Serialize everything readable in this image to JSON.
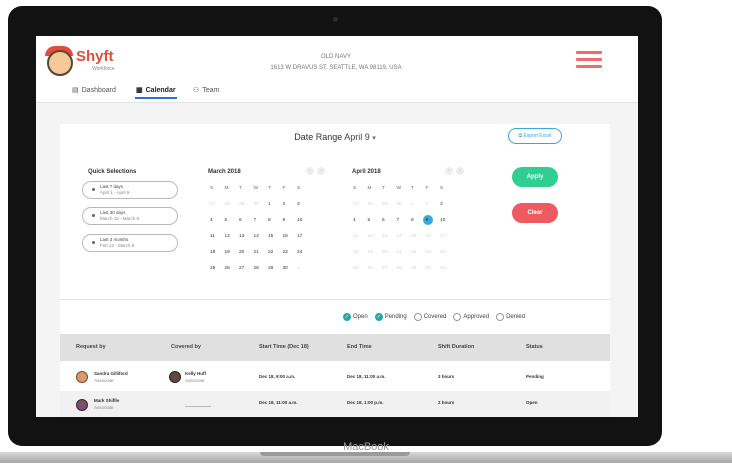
{
  "device_label": "MacBook",
  "app": {
    "brand": "Shyft",
    "brand_sub": "Workforce",
    "store_name": "OLD NAVY",
    "store_address": "1613 W DRAVUS ST. SEATTLE, WA 98119, USA"
  },
  "nav": {
    "dashboard": "Dashboard",
    "calendar": "Calendar",
    "team": "Team"
  },
  "date_range": {
    "label": "Date Range",
    "value": "April 9",
    "caret": "▾"
  },
  "export_label": "Export Excel",
  "quick_selections": {
    "title": "Quick Selections",
    "items": [
      {
        "label": "Last 7 days",
        "range": "April 1 - April 9"
      },
      {
        "label": "Last 30 days",
        "range": "March 15 - March 9"
      },
      {
        "label": "Last 3 months",
        "range": "Feb 13 - March 9"
      }
    ]
  },
  "calendars": [
    {
      "title": "March 2018",
      "weekdays": [
        "S",
        "M",
        "T",
        "W",
        "T",
        "F",
        "S"
      ],
      "weeks": [
        [
          "26",
          "27",
          "28",
          "29",
          "30",
          "1",
          "2",
          "3"
        ],
        [
          "4",
          "5",
          "6",
          "7",
          "8",
          "9",
          "10"
        ],
        [
          "11",
          "12",
          "13",
          "14",
          "15",
          "16",
          "17"
        ],
        [
          "18",
          "19",
          "20",
          "21",
          "22",
          "23",
          "24"
        ],
        [
          "25",
          "26",
          "27",
          "28",
          "29",
          "30",
          "1"
        ]
      ]
    },
    {
      "title": "April 2018",
      "weekdays": [
        "S",
        "M",
        "T",
        "W",
        "T",
        "F",
        "S"
      ],
      "weeks": [
        [
          "27",
          "28",
          "29",
          "30",
          "1",
          "2",
          "3"
        ],
        [
          "4",
          "5",
          "6",
          "7",
          "8",
          "9",
          "10"
        ],
        [
          "11",
          "12",
          "13",
          "14",
          "15",
          "16",
          "17"
        ],
        [
          "18",
          "19",
          "20",
          "21",
          "22",
          "23",
          "24"
        ],
        [
          "25",
          "26",
          "27",
          "28",
          "29",
          "30",
          "31"
        ]
      ]
    }
  ],
  "apply_label": "Apply",
  "clear_label": "Clear",
  "filters": [
    {
      "label": "Open",
      "checked": true
    },
    {
      "label": "Pending",
      "checked": true
    },
    {
      "label": "Covered",
      "checked": false
    },
    {
      "label": "Approved",
      "checked": false
    },
    {
      "label": "Denied",
      "checked": false
    }
  ],
  "table": {
    "headers": [
      "Request by",
      "Covered by",
      "Start Time (Dec 18)",
      "End Time",
      "Shift Duration",
      "Status"
    ],
    "rows": [
      {
        "request_name": "Sandra Gilliford",
        "request_role": "Associate",
        "covered_name": "Kelly Huff",
        "covered_role": "Associate",
        "start": "Dec 18, 9:00 a.m.",
        "end": "Dec 18, 11:00 a.m.",
        "duration": "3 hours",
        "status": "Pending"
      },
      {
        "request_name": "Mark Shiflle",
        "request_role": "Associate",
        "covered_name": "",
        "covered_role": "",
        "start": "Dec 18, 11:00 a.m.",
        "end": "Dec 18, 1:00 p.m.",
        "duration": "2 hours",
        "status": "Open"
      }
    ]
  },
  "colors": {
    "accent": "#39a7e0",
    "apply": "#2fcf93",
    "clear": "#ee5a5f",
    "brand": "#e04e39"
  }
}
